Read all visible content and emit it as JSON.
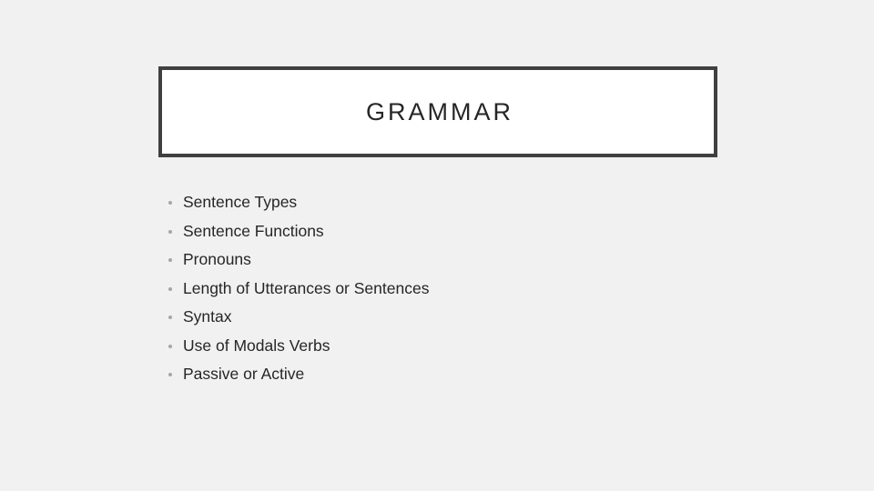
{
  "slide": {
    "title": "GRAMMAR",
    "bullets": [
      "Sentence Types",
      "Sentence Functions",
      "Pronouns",
      "Length of Utterances or Sentences",
      "Syntax",
      "Use of Modals Verbs",
      "Passive or Active"
    ]
  }
}
